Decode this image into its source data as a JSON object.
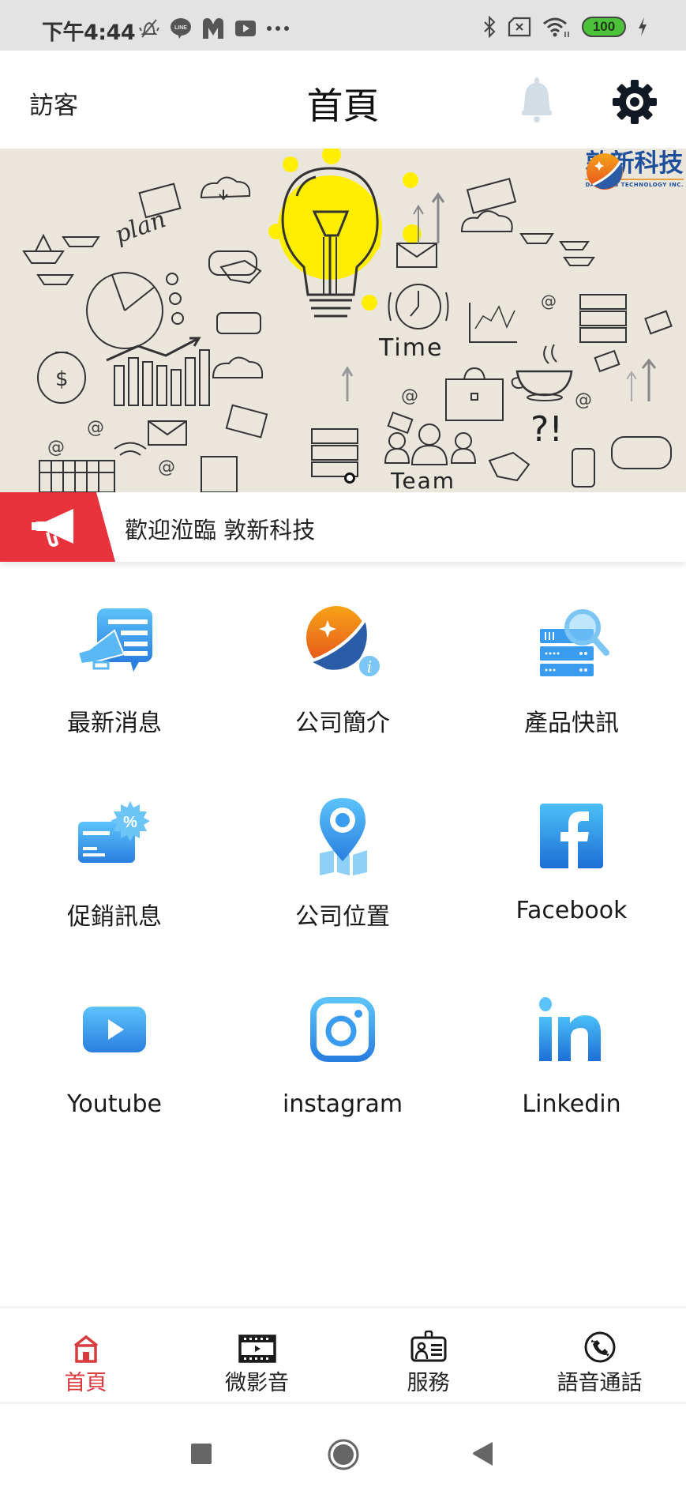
{
  "status_bar": {
    "time": "下午4:44",
    "left_icons": [
      "mute-bell-icon",
      "line-app-icon",
      "m-app-icon",
      "youtube-app-icon",
      "more-dots-icon"
    ],
    "right_icons": [
      "bluetooth-icon",
      "no-sim-icon",
      "wifi-icon",
      "battery-icon",
      "charging-icon"
    ],
    "battery_level": "100"
  },
  "header": {
    "guest_label": "訪客",
    "title": "首頁",
    "bell_icon": "bell-icon",
    "settings_icon": "gear-icon"
  },
  "banner": {
    "logo_name": "敦新科技",
    "logo_subtitle": "DAWNING TECHNOLOGY INC.",
    "doodle_words": [
      "plan",
      "Time",
      "Team",
      "?!"
    ],
    "carousel_pages": 1,
    "carousel_active": 1
  },
  "announcement": {
    "icon": "megaphone-icon",
    "text": "歡迎涖臨 敦新科技"
  },
  "grid": {
    "items": [
      {
        "label": "最新消息",
        "icon": "news-megaphone-icon"
      },
      {
        "label": "公司簡介",
        "icon": "company-info-icon"
      },
      {
        "label": "產品快訊",
        "icon": "product-search-icon"
      },
      {
        "label": "促銷訊息",
        "icon": "promo-card-icon"
      },
      {
        "label": "公司位置",
        "icon": "map-pin-icon"
      },
      {
        "label": "Facebook",
        "icon": "facebook-icon"
      },
      {
        "label": "Youtube",
        "icon": "youtube-icon"
      },
      {
        "label": "instagram",
        "icon": "instagram-icon"
      },
      {
        "label": "Linkedin",
        "icon": "linkedin-icon"
      }
    ]
  },
  "bottom_nav": {
    "tabs": [
      {
        "label": "首頁",
        "icon": "home-icon",
        "active": true
      },
      {
        "label": "微影音",
        "icon": "film-icon",
        "active": false
      },
      {
        "label": "服務",
        "icon": "id-badge-icon",
        "active": false
      },
      {
        "label": "語音通話",
        "icon": "phone-call-icon",
        "active": false
      }
    ]
  },
  "system_nav": {
    "buttons": [
      "recents-button",
      "home-button",
      "back-button"
    ]
  },
  "colors": {
    "accent_red": "#d83a3e",
    "announce_red": "#e8323c",
    "icon_blue": "#3a9cf0",
    "logo_blue": "#1d4f9c"
  }
}
